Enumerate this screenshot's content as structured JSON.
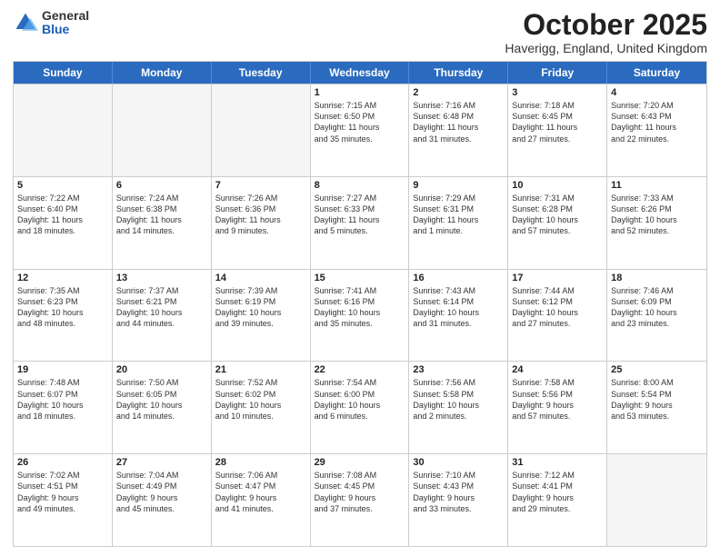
{
  "logo": {
    "general": "General",
    "blue": "Blue"
  },
  "title": "October 2025",
  "location": "Haverigg, England, United Kingdom",
  "weekdays": [
    "Sunday",
    "Monday",
    "Tuesday",
    "Wednesday",
    "Thursday",
    "Friday",
    "Saturday"
  ],
  "weeks": [
    [
      {
        "day": "",
        "info": ""
      },
      {
        "day": "",
        "info": ""
      },
      {
        "day": "",
        "info": ""
      },
      {
        "day": "1",
        "info": "Sunrise: 7:15 AM\nSunset: 6:50 PM\nDaylight: 11 hours\nand 35 minutes."
      },
      {
        "day": "2",
        "info": "Sunrise: 7:16 AM\nSunset: 6:48 PM\nDaylight: 11 hours\nand 31 minutes."
      },
      {
        "day": "3",
        "info": "Sunrise: 7:18 AM\nSunset: 6:45 PM\nDaylight: 11 hours\nand 27 minutes."
      },
      {
        "day": "4",
        "info": "Sunrise: 7:20 AM\nSunset: 6:43 PM\nDaylight: 11 hours\nand 22 minutes."
      }
    ],
    [
      {
        "day": "5",
        "info": "Sunrise: 7:22 AM\nSunset: 6:40 PM\nDaylight: 11 hours\nand 18 minutes."
      },
      {
        "day": "6",
        "info": "Sunrise: 7:24 AM\nSunset: 6:38 PM\nDaylight: 11 hours\nand 14 minutes."
      },
      {
        "day": "7",
        "info": "Sunrise: 7:26 AM\nSunset: 6:36 PM\nDaylight: 11 hours\nand 9 minutes."
      },
      {
        "day": "8",
        "info": "Sunrise: 7:27 AM\nSunset: 6:33 PM\nDaylight: 11 hours\nand 5 minutes."
      },
      {
        "day": "9",
        "info": "Sunrise: 7:29 AM\nSunset: 6:31 PM\nDaylight: 11 hours\nand 1 minute."
      },
      {
        "day": "10",
        "info": "Sunrise: 7:31 AM\nSunset: 6:28 PM\nDaylight: 10 hours\nand 57 minutes."
      },
      {
        "day": "11",
        "info": "Sunrise: 7:33 AM\nSunset: 6:26 PM\nDaylight: 10 hours\nand 52 minutes."
      }
    ],
    [
      {
        "day": "12",
        "info": "Sunrise: 7:35 AM\nSunset: 6:23 PM\nDaylight: 10 hours\nand 48 minutes."
      },
      {
        "day": "13",
        "info": "Sunrise: 7:37 AM\nSunset: 6:21 PM\nDaylight: 10 hours\nand 44 minutes."
      },
      {
        "day": "14",
        "info": "Sunrise: 7:39 AM\nSunset: 6:19 PM\nDaylight: 10 hours\nand 39 minutes."
      },
      {
        "day": "15",
        "info": "Sunrise: 7:41 AM\nSunset: 6:16 PM\nDaylight: 10 hours\nand 35 minutes."
      },
      {
        "day": "16",
        "info": "Sunrise: 7:43 AM\nSunset: 6:14 PM\nDaylight: 10 hours\nand 31 minutes."
      },
      {
        "day": "17",
        "info": "Sunrise: 7:44 AM\nSunset: 6:12 PM\nDaylight: 10 hours\nand 27 minutes."
      },
      {
        "day": "18",
        "info": "Sunrise: 7:46 AM\nSunset: 6:09 PM\nDaylight: 10 hours\nand 23 minutes."
      }
    ],
    [
      {
        "day": "19",
        "info": "Sunrise: 7:48 AM\nSunset: 6:07 PM\nDaylight: 10 hours\nand 18 minutes."
      },
      {
        "day": "20",
        "info": "Sunrise: 7:50 AM\nSunset: 6:05 PM\nDaylight: 10 hours\nand 14 minutes."
      },
      {
        "day": "21",
        "info": "Sunrise: 7:52 AM\nSunset: 6:02 PM\nDaylight: 10 hours\nand 10 minutes."
      },
      {
        "day": "22",
        "info": "Sunrise: 7:54 AM\nSunset: 6:00 PM\nDaylight: 10 hours\nand 6 minutes."
      },
      {
        "day": "23",
        "info": "Sunrise: 7:56 AM\nSunset: 5:58 PM\nDaylight: 10 hours\nand 2 minutes."
      },
      {
        "day": "24",
        "info": "Sunrise: 7:58 AM\nSunset: 5:56 PM\nDaylight: 9 hours\nand 57 minutes."
      },
      {
        "day": "25",
        "info": "Sunrise: 8:00 AM\nSunset: 5:54 PM\nDaylight: 9 hours\nand 53 minutes."
      }
    ],
    [
      {
        "day": "26",
        "info": "Sunrise: 7:02 AM\nSunset: 4:51 PM\nDaylight: 9 hours\nand 49 minutes."
      },
      {
        "day": "27",
        "info": "Sunrise: 7:04 AM\nSunset: 4:49 PM\nDaylight: 9 hours\nand 45 minutes."
      },
      {
        "day": "28",
        "info": "Sunrise: 7:06 AM\nSunset: 4:47 PM\nDaylight: 9 hours\nand 41 minutes."
      },
      {
        "day": "29",
        "info": "Sunrise: 7:08 AM\nSunset: 4:45 PM\nDaylight: 9 hours\nand 37 minutes."
      },
      {
        "day": "30",
        "info": "Sunrise: 7:10 AM\nSunset: 4:43 PM\nDaylight: 9 hours\nand 33 minutes."
      },
      {
        "day": "31",
        "info": "Sunrise: 7:12 AM\nSunset: 4:41 PM\nDaylight: 9 hours\nand 29 minutes."
      },
      {
        "day": "",
        "info": ""
      }
    ]
  ]
}
